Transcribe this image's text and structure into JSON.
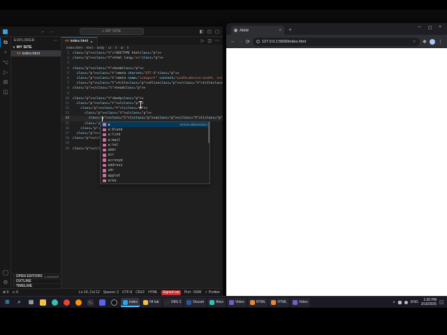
{
  "colors": {
    "accent": "#0078d4",
    "tag": "#569cd6",
    "attribute": "#9cdcfe",
    "string": "#ce9178",
    "punctuation": "#808080",
    "code_text": "#d4d4d4",
    "alert_badge": "#cd3131",
    "html_icon": "#e8883a",
    "suggest_icon": "#d16d9e"
  },
  "vscode": {
    "titlebar": {
      "back_icon": "←",
      "forward_icon": "→",
      "search_icon": "⌕",
      "search_label": "MY SITE",
      "layout_icons": [
        "◧",
        "◫",
        "▢"
      ]
    },
    "activity_bar": {
      "top": [
        {
          "name": "explorer",
          "glyph": "⧉",
          "active": true
        },
        {
          "name": "search",
          "glyph": "⌕"
        },
        {
          "name": "source-control",
          "glyph": "⌥"
        },
        {
          "name": "run-debug",
          "glyph": "▷"
        },
        {
          "name": "extensions",
          "glyph": "⊞"
        },
        {
          "name": "remote-explorer",
          "glyph": "◫"
        }
      ],
      "bottom": [
        {
          "name": "account",
          "glyph": "◯"
        },
        {
          "name": "settings",
          "glyph": "⚙"
        }
      ]
    },
    "sidebar": {
      "header": "EXPLORER",
      "header_more_icon": "⋯",
      "folder_chevron": "∨",
      "folder": "MY SITE",
      "file_icon": "<>",
      "file": "index.html",
      "section_chevron": "›",
      "sections": [
        {
          "label": "OPEN EDITORS",
          "badge": "1 unsaved"
        },
        {
          "label": "OUTLINE",
          "badge": ""
        },
        {
          "label": "TIMELINE",
          "badge": ""
        }
      ]
    },
    "editor": {
      "tab": {
        "label": "index.html",
        "icon": "<>",
        "modified_dot": "●"
      },
      "tab_actions": [
        "▷",
        "◫",
        "⋯"
      ],
      "breadcrumb_sep": "›",
      "breadcrumbs": [
        "index.html",
        "html",
        "body",
        "ul",
        "li",
        "ul",
        "li"
      ],
      "active_line": 14,
      "lines": [
        "<!DOCTYPE html>",
        "<html lang=\"en\">",
        "",
        "<head>",
        "  <meta charset=\"UTF-8\">",
        "  <meta name=\"viewport\" content=\"width=device-width, initial-scale=1.0\">",
        "  <title>Alice</title>",
        "</head>",
        "",
        "<body>",
        "  <ul>",
        "    <li>",
        "      <ul>",
        "        <li>a</li>",
        "      </ul>",
        "    </li>",
        "  </ul>",
        "</body>",
        "",
        "</html>"
      ]
    },
    "suggest": {
      "selected_index": 0,
      "selected_detail": "emmet abbreviation",
      "items": [
        "a",
        "a:blank",
        "a:link",
        "a:mail",
        "a:tel",
        "abbr",
        "acr",
        "acronym",
        "address",
        "adr",
        "applet",
        "area"
      ]
    },
    "statusbar": {
      "left": [
        {
          "name": "errors",
          "label": "⊗ 0"
        },
        {
          "name": "warnings",
          "label": "⚠ 0"
        }
      ],
      "right": [
        {
          "name": "cursor-position",
          "label": "Ln 14, Col 12"
        },
        {
          "name": "indentation",
          "label": "Spaces: 2"
        },
        {
          "name": "encoding",
          "label": "UTF-8"
        },
        {
          "name": "eol",
          "label": "CRLF"
        },
        {
          "name": "language-mode",
          "label": "HTML"
        },
        {
          "name": "signed-out",
          "label": "Signed out",
          "alert": true
        },
        {
          "name": "live-server-port",
          "label": "Port : 5500"
        },
        {
          "name": "prettier",
          "label": "✓ Prettier"
        }
      ]
    }
  },
  "browser": {
    "tab_title": "Alice",
    "tab_close_icon": "×",
    "new_tab_icon": "+",
    "window_controls": [
      "─",
      "▢",
      "×"
    ],
    "back_icon": "←",
    "forward_icon": "→",
    "refresh_icon": "⟳",
    "url": "127.0.0.1:5500/index.html",
    "bookmark_star_icon": "☆",
    "extensions_icon": "❖",
    "menu_icon": "⋮"
  },
  "taskbar": {
    "pinned": [
      {
        "name": "start-button",
        "glyph": "⊞",
        "fg": "#4cc2ff"
      },
      {
        "name": "search-button",
        "glyph": "⌕",
        "fg": "#dfe3ea"
      },
      {
        "name": "task-view-button",
        "glyph": "▦",
        "fg": "#cdd3dd"
      },
      {
        "name": "file-explorer",
        "shape": "square",
        "bg": "#f6c244"
      },
      {
        "name": "edge-browser",
        "shape": "circle",
        "bg": "#36c3b4"
      },
      {
        "name": "chrome-browser",
        "shape": "circle",
        "bg": "#e94435"
      },
      {
        "name": "firefox-browser",
        "shape": "circle",
        "bg": "#ff9500"
      },
      {
        "name": "terminal",
        "shape": "square",
        "bg": "#333333",
        "glyph": ">_",
        "fg": "#ffffff"
      },
      {
        "name": "discord",
        "shape": "square",
        "bg": "#5865f2"
      },
      {
        "name": "obs-studio",
        "shape": "circle",
        "bg": "#101010",
        "border": "#9a9a9a"
      }
    ],
    "windows": [
      {
        "name": "vscode",
        "label": "index",
        "chip": "#2ea3e8",
        "active": true
      },
      {
        "name": "folder-04-lab",
        "label": "04 lab",
        "chip": "#f6c244"
      },
      {
        "name": "obs",
        "label": "OBS 3",
        "chip": "#2b2b2b"
      },
      {
        "name": "word-document",
        "label": "Docum",
        "chip": "#2b579a"
      },
      {
        "name": "browser-alice",
        "label": "Alice",
        "chip": "#36c3b4"
      },
      {
        "name": "video-1",
        "label": "Video",
        "chip": "#7a5cc5"
      },
      {
        "name": "html-1",
        "label": "HTML",
        "chip": "#e8883a"
      },
      {
        "name": "html-2",
        "label": "HTML",
        "chip": "#e8883a"
      },
      {
        "name": "video-2",
        "label": "Video",
        "chip": "#7a5cc5"
      }
    ],
    "tray": {
      "hidden_icons_chevron": "∧",
      "language": "ENG",
      "time": "1:30 PM",
      "date": "3/16/2025"
    }
  }
}
